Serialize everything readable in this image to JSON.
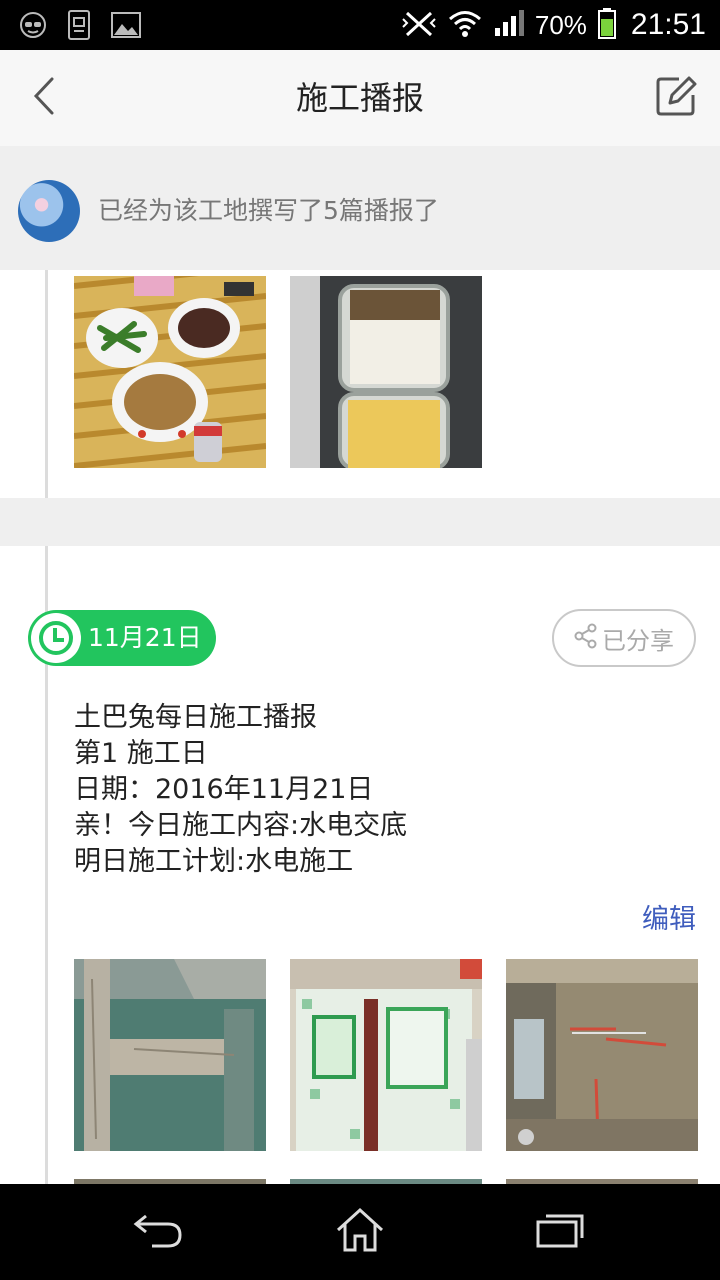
{
  "status_bar": {
    "left_icons": [
      "incognito-icon",
      "phone-sync-icon",
      "image-icon"
    ],
    "battery_percent": "70%",
    "time": "21:51"
  },
  "header": {
    "title": "施工播报",
    "back_icon": "chevron-left-icon",
    "edit_icon": "compose-icon"
  },
  "banner": {
    "text": "已经为该工地撰写了5篇播报了"
  },
  "post": {
    "date": "11月21日",
    "share_label": "已分享",
    "lines": [
      "土巴兔每日施工播报",
      "第1  施工日",
      "日期：2016年11月21日",
      "亲！今日施工内容:水电交底",
      "明日施工计划:水电施工"
    ],
    "edit_label": "编辑"
  },
  "colors": {
    "accent_green": "#22c55e",
    "edit_link_blue": "#3f5dbd",
    "banner_bg": "#efefef"
  }
}
